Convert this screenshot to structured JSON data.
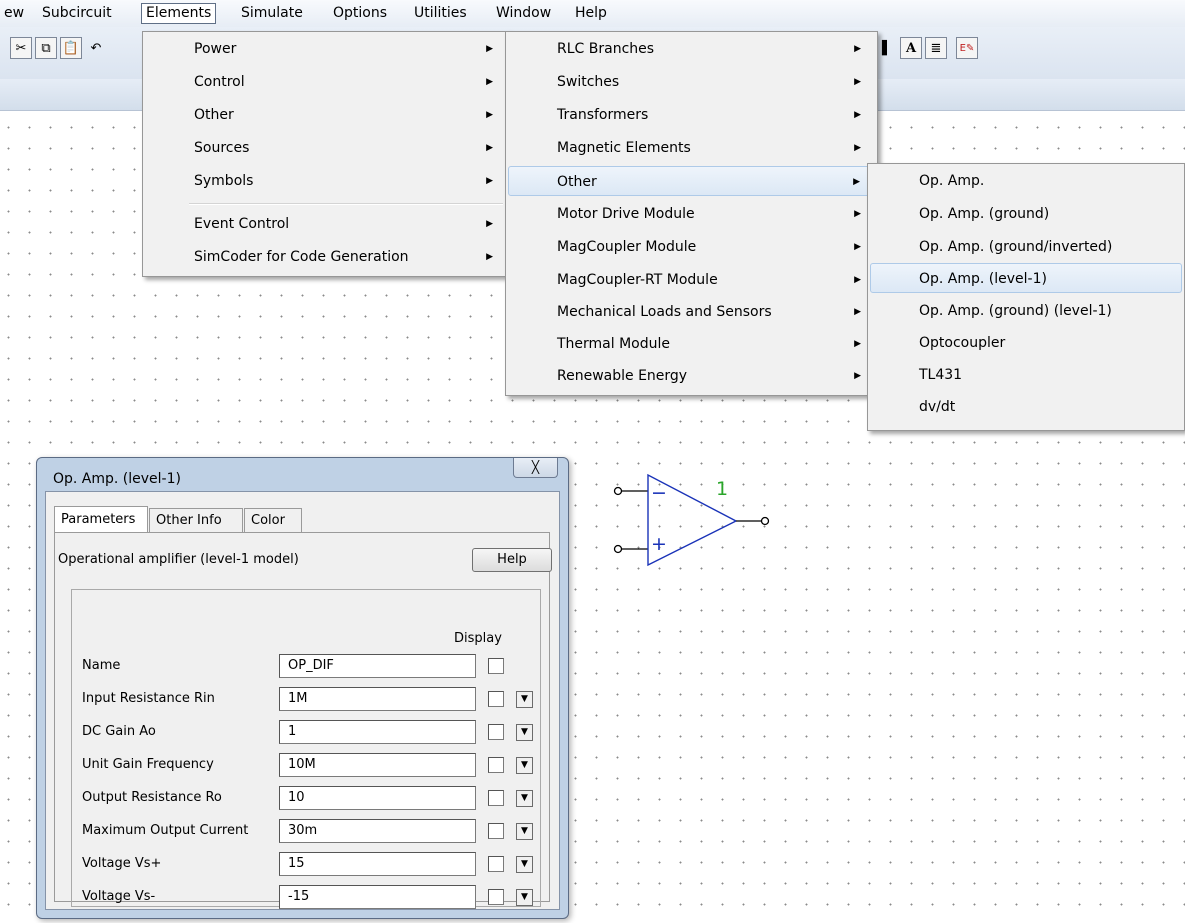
{
  "menubar": {
    "items": [
      "ew",
      "Subcircuit",
      "Elements",
      "Simulate",
      "Options",
      "Utilities",
      "Window",
      "Help"
    ],
    "active": "Elements"
  },
  "elements_menu": {
    "items": [
      {
        "label": "Power",
        "submenu": true
      },
      {
        "label": "Control",
        "submenu": true
      },
      {
        "label": "Other",
        "submenu": true
      },
      {
        "label": "Sources",
        "submenu": true
      },
      {
        "label": "Symbols",
        "submenu": true
      },
      {
        "label": "Event Control",
        "submenu": true
      },
      {
        "label": "SimCoder for Code Generation",
        "submenu": true
      }
    ]
  },
  "power_menu": {
    "items": [
      {
        "label": "RLC Branches",
        "submenu": true
      },
      {
        "label": "Switches",
        "submenu": true
      },
      {
        "label": "Transformers",
        "submenu": true
      },
      {
        "label": "Magnetic Elements",
        "submenu": true
      },
      {
        "label": "Other",
        "submenu": true,
        "highlighted": true
      },
      {
        "label": "Motor Drive Module",
        "submenu": true
      },
      {
        "label": "MagCoupler Module",
        "submenu": true
      },
      {
        "label": "MagCoupler-RT Module",
        "submenu": true
      },
      {
        "label": "Mechanical Loads and Sensors",
        "submenu": true
      },
      {
        "label": "Thermal Module",
        "submenu": true
      },
      {
        "label": "Renewable Energy",
        "submenu": true
      }
    ]
  },
  "other_menu": {
    "items": [
      {
        "label": "Op. Amp."
      },
      {
        "label": "Op. Amp. (ground)"
      },
      {
        "label": "Op. Amp. (ground/inverted)"
      },
      {
        "label": "Op. Amp. (level-1)",
        "highlighted": true
      },
      {
        "label": "Op. Amp. (ground) (level-1)"
      },
      {
        "label": "Optocoupler"
      },
      {
        "label": "TL431"
      },
      {
        "label": "dv/dt"
      }
    ]
  },
  "toolbar": {
    "text_tool": "A",
    "pen_tool_label": "E"
  },
  "dialog": {
    "title": "Op. Amp. (level-1)",
    "close_glyph": "╳",
    "tabs": [
      "Parameters",
      "Other Info",
      "Color"
    ],
    "selected_tab": "Parameters",
    "description": "Operational amplifier (level-1 model)",
    "help_label": "Help",
    "display_header": "Display",
    "params": [
      {
        "label": "Name",
        "value": "OP_DIF",
        "display": false,
        "has_dropdown": false
      },
      {
        "label": "Input Resistance Rin",
        "value": "1M",
        "display": false,
        "has_dropdown": true
      },
      {
        "label": "DC Gain Ao",
        "value": "1",
        "display": false,
        "has_dropdown": true
      },
      {
        "label": "Unit Gain Frequency",
        "value": "10M",
        "display": false,
        "has_dropdown": true
      },
      {
        "label": "Output Resistance Ro",
        "value": "10",
        "display": false,
        "has_dropdown": true
      },
      {
        "label": "Maximum Output Current",
        "value": "30m",
        "display": false,
        "has_dropdown": true
      },
      {
        "label": "Voltage Vs+",
        "value": "15",
        "display": false,
        "has_dropdown": true
      },
      {
        "label": "Voltage Vs-",
        "value": "-15",
        "display": false,
        "has_dropdown": true
      }
    ]
  },
  "opamp_symbol": {
    "ref_label": "1",
    "minus_sign": "−",
    "plus_sign": "+",
    "color": "#1a33b8",
    "label_color": "#2aa52a"
  }
}
